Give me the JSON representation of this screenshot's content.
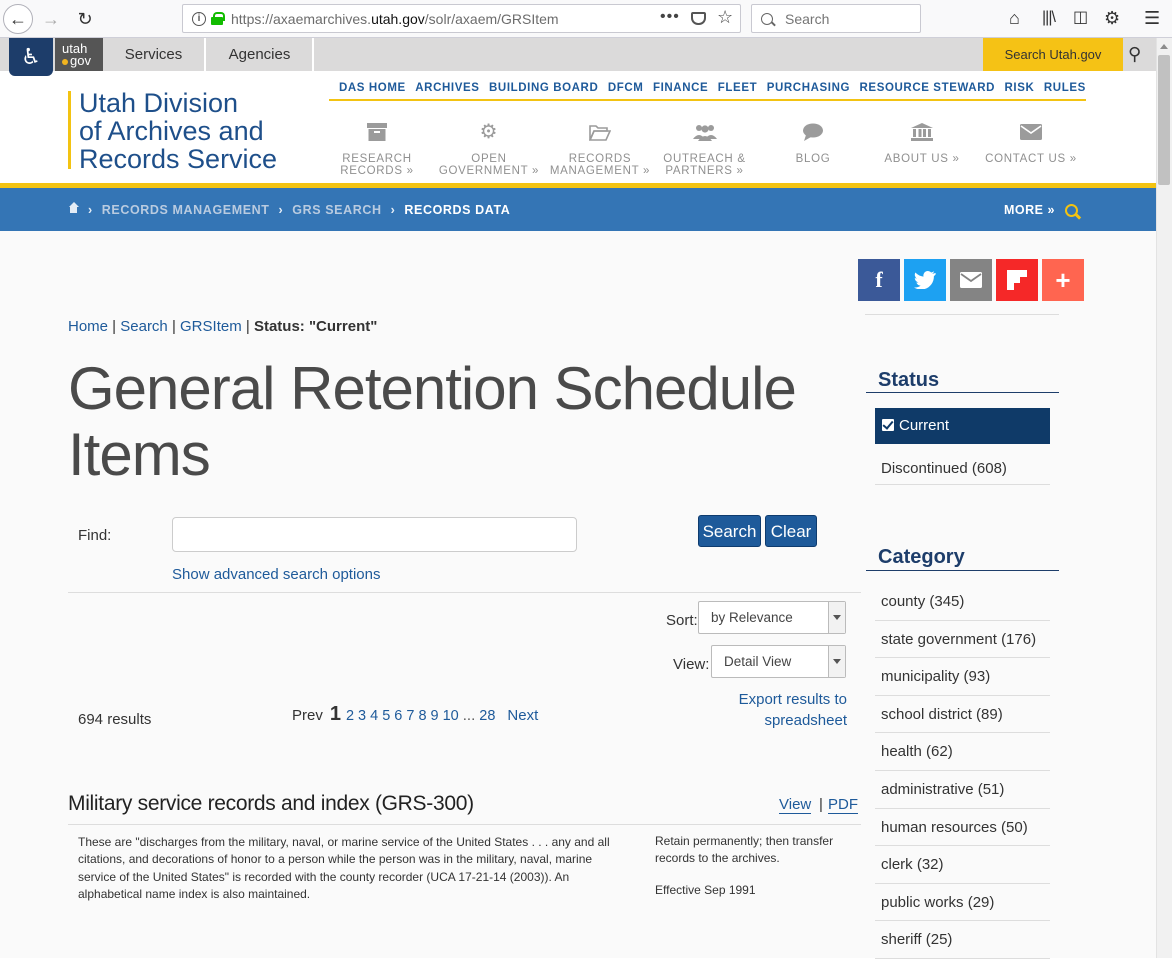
{
  "browser": {
    "url_prefix": "https://axaemarchives.",
    "url_domain": "utah.gov",
    "url_suffix": "/solr/axaem/GRSItem",
    "search_placeholder": "Search"
  },
  "utahbar": {
    "logo_top": "utah",
    "logo_bottom": "gov",
    "tabs": [
      "Services",
      "Agencies"
    ],
    "search_label": "Search Utah.gov"
  },
  "site": {
    "logo_lines": [
      "Utah Division",
      "of Archives and",
      "Records Service"
    ],
    "topnav": [
      "DAS HOME",
      "ARCHIVES",
      "BUILDING BOARD",
      "DFCM",
      "FINANCE",
      "FLEET",
      "PURCHASING",
      "RESOURCE STEWARD",
      "RISK",
      "RULES"
    ],
    "mainnav": [
      {
        "line1": "RESEARCH",
        "line2": "RECORDS",
        "icon": "archive-box-icon"
      },
      {
        "line1": "OPEN",
        "line2": "GOVERNMENT",
        "icon": "gear-icon"
      },
      {
        "line1": "RECORDS",
        "line2": "MANAGEMENT",
        "icon": "folder-open-icon"
      },
      {
        "line1": "OUTREACH &",
        "line2": "PARTNERS",
        "icon": "users-icon"
      },
      {
        "line1": "BLOG",
        "line2": "",
        "icon": "comment-icon"
      },
      {
        "line1": "ABOUT US",
        "line2": "",
        "icon": "institution-icon"
      },
      {
        "line1": "CONTACT US",
        "line2": "",
        "icon": "envelope-icon"
      }
    ]
  },
  "crumbbar": {
    "items": [
      "RECORDS MANAGEMENT",
      "GRS SEARCH"
    ],
    "current": "RECORDS DATA",
    "more": "MORE"
  },
  "page": {
    "crumb_links": [
      "Home",
      "Search",
      "GRSItem"
    ],
    "crumb_current": "Status: \"Current\"",
    "title": "General Retention Schedule Items",
    "find_label": "Find:",
    "find_value": "",
    "search_btn": "Search",
    "clear_btn": "Clear",
    "advanced_link": "Show advanced search options",
    "sort_label": "Sort:",
    "sort_value": "by Relevance",
    "view_label": "View:",
    "view_value": "Detail View",
    "export_line1": "Export results to",
    "export_line2": "spreadsheet",
    "results_count": "694 results",
    "pager": {
      "prev": "Prev",
      "current": "1",
      "pages": [
        "2",
        "3",
        "4",
        "5",
        "6",
        "7",
        "8",
        "9",
        "10"
      ],
      "ellipsis": "...",
      "last": "28",
      "next": "Next"
    }
  },
  "item": {
    "title": "Military service records and index (GRS-300)",
    "view_link": "View",
    "separator": "|",
    "pdf_link": "PDF",
    "description": "These are \"discharges from the military, naval, or marine service of the United States . . . any and all citations, and decorations of honor to a person while the person was in the military, naval, marine service of the United States\" is recorded with the county recorder (UCA 17-21-14 (2003)). An alphabetical name index is also maintained.",
    "retention": "Retain permanently; then transfer records to the archives.",
    "effective": "Effective Sep 1991"
  },
  "sidebar": {
    "status_heading": "Status",
    "status_current": "Current",
    "status_discontinued": "Discontinued (608)",
    "category_heading": "Category",
    "categories": [
      "county (345)",
      "state government (176)",
      "municipality (93)",
      "school district (89)",
      "health (62)",
      "administrative (51)",
      "human resources (50)",
      "clerk (32)",
      "public works (29)",
      "sheriff (25)"
    ]
  }
}
